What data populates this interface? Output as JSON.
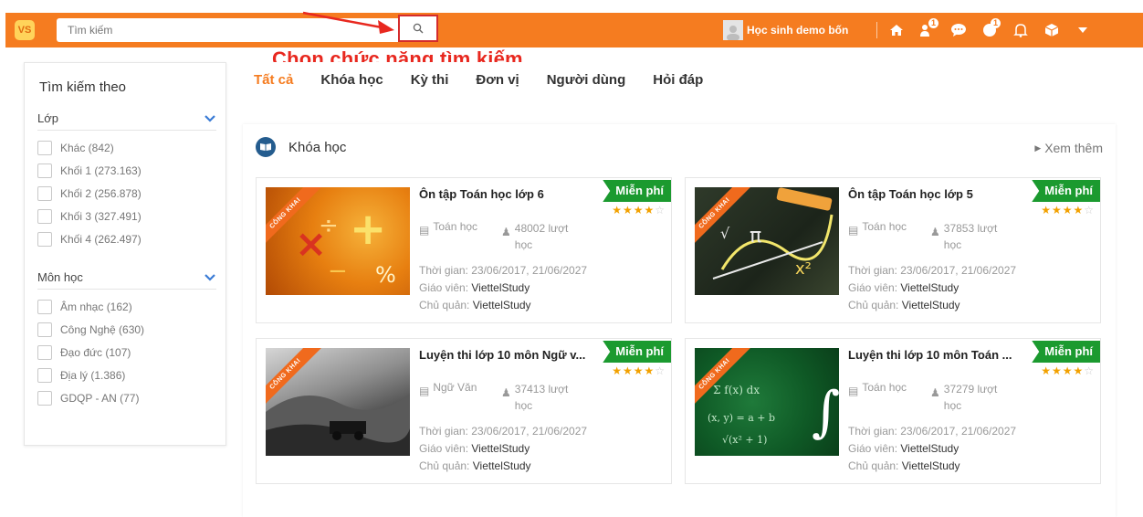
{
  "header": {
    "logo": "VS",
    "search_placeholder": "Tìm kiếm",
    "user_name": "Học sinh demo bốn",
    "badges": {
      "users": "1",
      "notifications": "1"
    },
    "accent": "#f57c20"
  },
  "annotation": {
    "text": "Chọn chức năng tìm kiếm",
    "color": "#e8281f"
  },
  "sidebar": {
    "title": "Tìm kiếm theo",
    "groups": [
      {
        "label": "Lớp",
        "items": [
          "Khác (842)",
          "Khối 1 (273.163)",
          "Khối 2 (256.878)",
          "Khối 3 (327.491)",
          "Khối 4 (262.497)"
        ]
      },
      {
        "label": "Môn học",
        "items": [
          "Âm nhạc (162)",
          "Công Nghệ (630)",
          "Đạo đức (107)",
          "Địa lý (1.386)",
          "GDQP - AN (77)"
        ]
      }
    ]
  },
  "tabs": [
    "Tất cả",
    "Khóa học",
    "Kỳ thi",
    "Đơn vị",
    "Người dùng",
    "Hỏi đáp"
  ],
  "section": {
    "title": "Khóa học",
    "more": "Xem thêm"
  },
  "courses": [
    {
      "title": "Ôn tập Toán học lớp 6",
      "ribbon": "CÔNG KHAI",
      "price": "Miễn phí",
      "rating": 4,
      "subject": "Toán học",
      "views": "48002 lượt",
      "views_unit": "học",
      "time_label": "Thời gian:",
      "time": "23/06/2017, 21/06/2027",
      "teacher_label": "Giáo viên:",
      "teacher": "ViettelStudy",
      "owner_label": "Chủ quản:",
      "owner": "ViettelStudy"
    },
    {
      "title": "Ôn tập Toán học lớp 5",
      "ribbon": "CÔNG KHAI",
      "price": "Miễn phí",
      "rating": 4,
      "subject": "Toán học",
      "views": "37853 lượt",
      "views_unit": "học",
      "time_label": "Thời gian:",
      "time": "23/06/2017, 21/06/2027",
      "teacher_label": "Giáo viên:",
      "teacher": "ViettelStudy",
      "owner_label": "Chủ quản:",
      "owner": "ViettelStudy"
    },
    {
      "title": "Luyện thi lớp 10 môn Ngữ v...",
      "ribbon": "CÔNG KHAI",
      "price": "Miễn phí",
      "rating": 4,
      "subject": "Ngữ Văn",
      "views": "37413 lượt",
      "views_unit": "học",
      "time_label": "Thời gian:",
      "time": "23/06/2017, 21/06/2027",
      "teacher_label": "Giáo viên:",
      "teacher": "ViettelStudy",
      "owner_label": "Chủ quản:",
      "owner": "ViettelStudy"
    },
    {
      "title": "Luyện thi lớp 10 môn Toán ...",
      "ribbon": "CÔNG KHAI",
      "price": "Miễn phí",
      "rating": 4,
      "subject": "Toán học",
      "views": "37279 lượt",
      "views_unit": "học",
      "time_label": "Thời gian:",
      "time": "23/06/2017, 21/06/2027",
      "teacher_label": "Giáo viên:",
      "teacher": "ViettelStudy",
      "owner_label": "Chủ quản:",
      "owner": "ViettelStudy"
    }
  ]
}
